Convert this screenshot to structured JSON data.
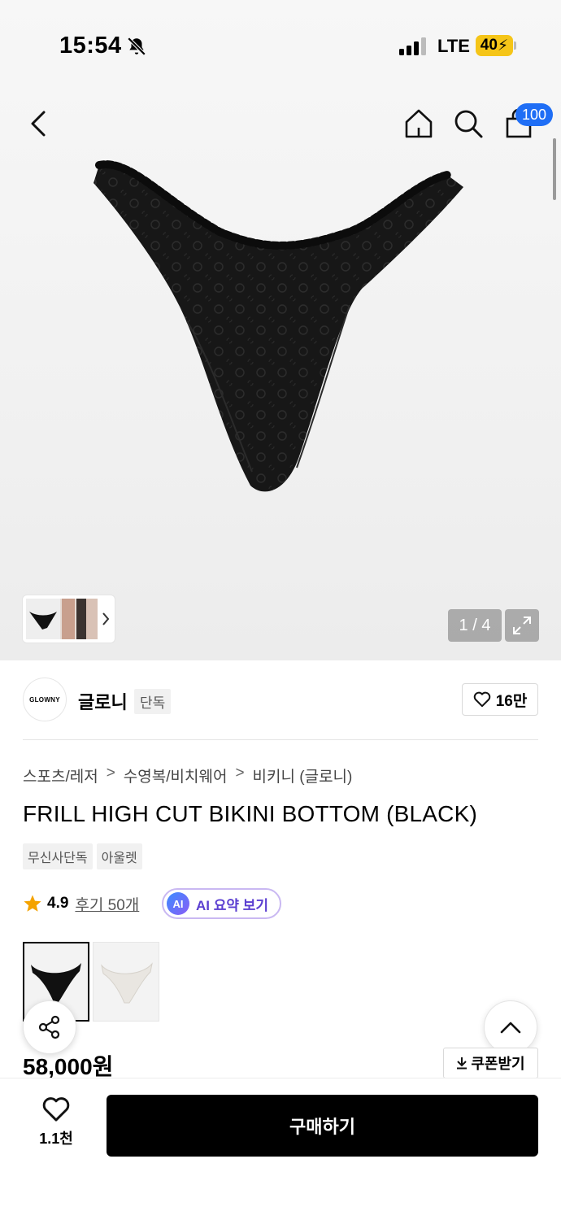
{
  "status_bar": {
    "time": "15:54",
    "network": "LTE",
    "battery": "40"
  },
  "nav": {
    "cart_count": "100"
  },
  "gallery": {
    "page_indicator": "1 / 4"
  },
  "brand": {
    "logo_text": "GLOWNY",
    "name": "글로니",
    "tag": "단독",
    "likes": "16만"
  },
  "breadcrumb": [
    "스포츠/레저",
    ">",
    "수영복/비치웨어",
    ">",
    "비키니 (글로니)"
  ],
  "product": {
    "title": "FRILL HIGH CUT BIKINI BOTTOM (BLACK)",
    "tags": [
      "무신사단독",
      "아울렛"
    ],
    "rating": "4.9",
    "review_link": "후기 50개",
    "ai_badge": "AI",
    "ai_summary": "AI 요약 보기",
    "price": "58,000원",
    "coupon": "쿠폰받기",
    "color_options": [
      "black",
      "ivory"
    ]
  },
  "bottom_bar": {
    "wish_count": "1.1천",
    "buy_label": "구매하기"
  },
  "colors": {
    "accent_blue": "#1f6ef5",
    "star": "#f4a300",
    "ai_purple": "#5b3fd1",
    "battery": "#f5c518"
  },
  "icons": [
    "bell-off-icon",
    "signal-icon",
    "back-icon",
    "home-icon",
    "search-icon",
    "cart-icon",
    "chevron-right-icon",
    "expand-icon",
    "heart-icon",
    "star-icon",
    "share-icon",
    "chevron-up-icon",
    "download-icon"
  ]
}
